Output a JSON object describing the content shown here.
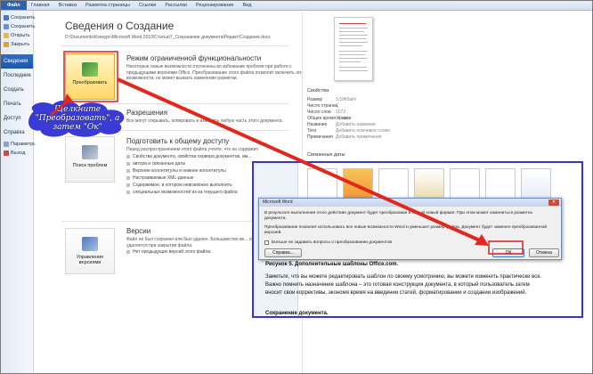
{
  "ribbon": {
    "tabs": [
      "Файл",
      "Главная",
      "Вставка",
      "Разметка страницы",
      "Ссылки",
      "Рассылки",
      "Рецензирование",
      "Вид"
    ]
  },
  "nav": {
    "commands_top": [
      "Сохранить",
      "Сохранить как",
      "Открыть",
      "Закрыть"
    ],
    "tabs": [
      "Сведения",
      "Последние",
      "Создать",
      "Печать",
      "Доступ",
      "Справка"
    ],
    "commands_bottom": [
      "Параметры",
      "Выход"
    ]
  },
  "info": {
    "title": "Сведения о Создание",
    "path": "D:\\Documents\\Конкурс\\Microsoft Word 2010\\Статьи\\7_Сохранение документа\\Редакт\\Создание.docx",
    "convert": {
      "button_label": "Преобразовать",
      "heading": "Режим ограниченной функциональности",
      "description": "Некоторые новые возможности отключены во избежание проблем при работе с предыдущими версиями Office. Преобразование этого файла позволит включить эти возможности, но может вызвать изменение разметки."
    },
    "permissions": {
      "heading": "Разрешения",
      "description": "Все могут открывать, копировать и изменять любую часть этого документа."
    },
    "prepare": {
      "button_label": "Поиск проблем",
      "heading": "Подготовить к общему доступу",
      "description": "Перед распространением этого файла учтите, что он содержит:",
      "bullets": [
        "Свойства документа, свойства сервера документов, им...",
        "автора и связанные даты",
        "Верхние колонтитулы и нижние колонтитулы",
        "Настраиваемые XML-данные",
        "Содержимое, в котором невозможно выполнить",
        "специальных возможностей из-за текущего файла"
      ]
    },
    "versions": {
      "button_label": "Управление версиями",
      "heading": "Версии",
      "description": "Файл не был сохранен или был удален. Большинство ве... сохраненных версий удаляется при закрытии файла.",
      "note": "Нет предыдущих версий этого файла."
    }
  },
  "properties": {
    "header": "Свойства",
    "rows": [
      {
        "k": "Размер",
        "v": "3,59Кбайт"
      },
      {
        "k": "Число страниц",
        "v": "7"
      },
      {
        "k": "Число слов",
        "v": "1072"
      },
      {
        "k": "Общее время правки",
        "v": "14 мин"
      },
      {
        "k": "Название",
        "v": "Добавить название"
      },
      {
        "k": "Теги",
        "v": "Добавить ключевое слово"
      },
      {
        "k": "Примечания",
        "v": "Добавить примечания"
      }
    ],
    "related_header": "Связанные даты"
  },
  "dialog": {
    "title": "Microsoft Word",
    "message1": "В результате выполнения этого действия документ будет преобразован в самый новый формат. При этом может измениться разметка документа.",
    "message2": "Преобразование позволит использовать все новые возможности Word и уменьшит размер файла. Документ будет заменен преобразованной версией.",
    "checkbox": "Больше не задавать вопросы о преобразовании документов",
    "help": "Справка...",
    "ok": "ОК",
    "cancel": "Отмена"
  },
  "document": {
    "caption": "Рисунок 5. Дополнительные шаблоны Office.com.",
    "paragraph": [
      "Заметьте, что вы можете редактировать шаблон по своему усмотрению, вы можете изменить практически все.",
      "Важно помнить назначение шаблона – это готовая конструкция документа, в который пользователь затем",
      "вносит свои коррективы, экономя время на введении статей, форматировании и создании изображений."
    ],
    "heading": "Сохранение документа."
  },
  "annotation": {
    "text": "Щелкните \"Преобразовать\", а затем \"Ок\"",
    "color": "#3a3ad6"
  },
  "colors": {
    "arrow": "#e2281c",
    "file_tab": "#2a62b4",
    "highlight_box": "#d42020"
  }
}
